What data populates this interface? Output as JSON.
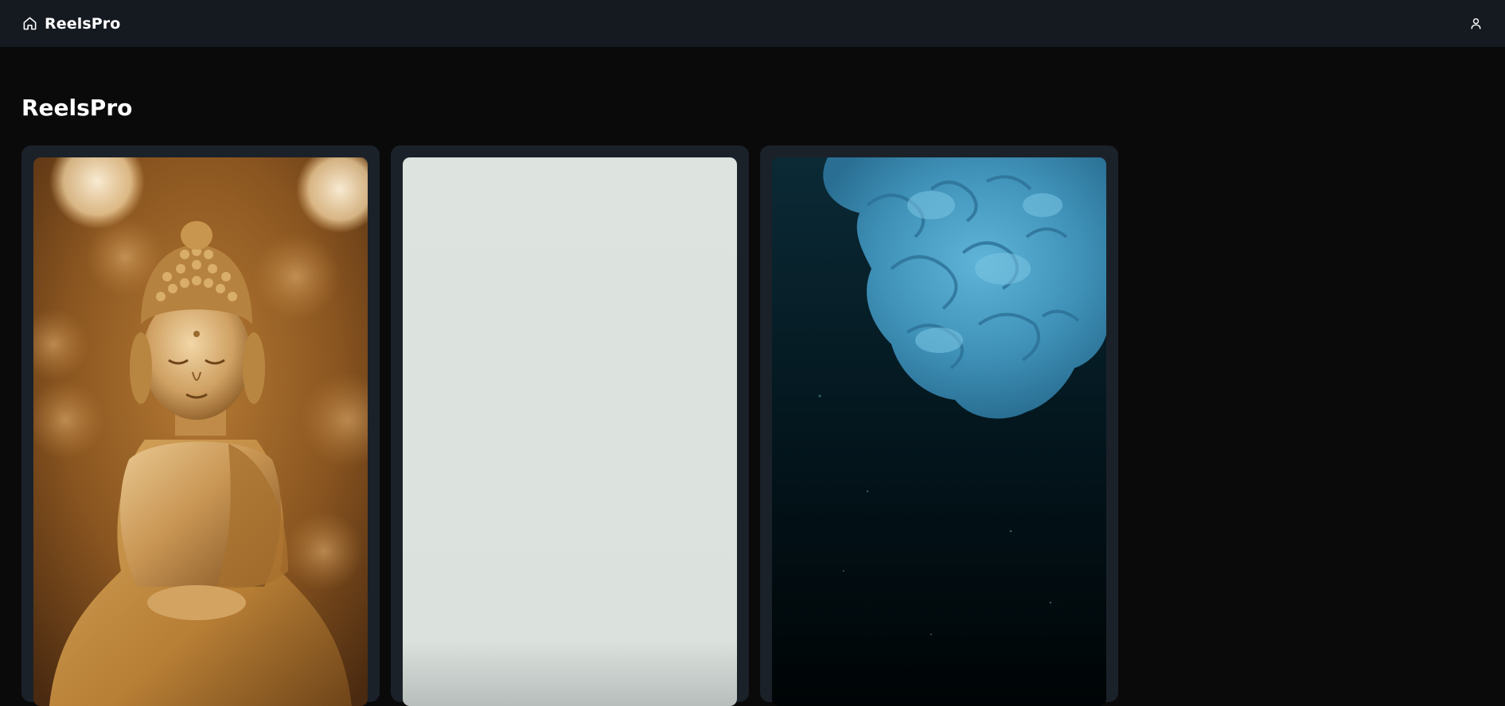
{
  "navbar": {
    "brand": "ReelsPro",
    "home_icon": "home-icon",
    "user_icon": "user-icon"
  },
  "main": {
    "title": "ReelsPro",
    "videos": [
      {
        "thumbnail": "golden-buddha-statue",
        "accent": "#c9954a"
      },
      {
        "thumbnail": "plain-light-grey",
        "accent": "#dce2de"
      },
      {
        "thumbnail": "blue-ink-in-dark-water",
        "accent": "#4aa3c8"
      }
    ]
  },
  "colors": {
    "background": "#0a0a0b",
    "navbar": "#151a21",
    "card": "#1b2129",
    "text": "#ffffff"
  }
}
